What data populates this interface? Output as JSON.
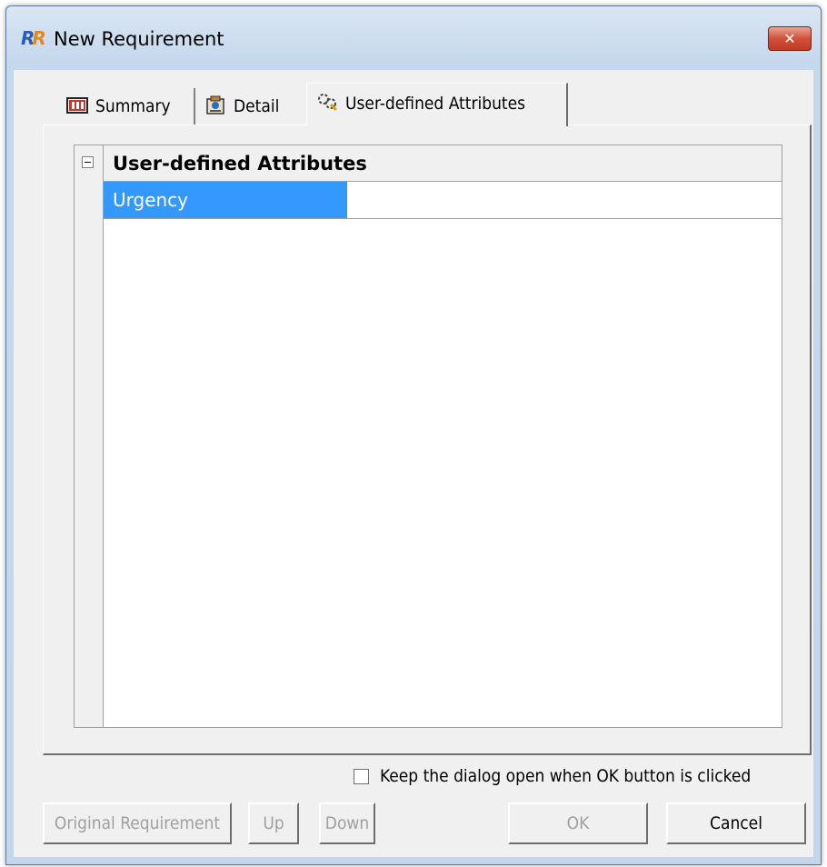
{
  "window": {
    "title": "New Requirement",
    "close_glyph": "✕"
  },
  "tabs": [
    {
      "label": "Summary",
      "icon": "summary-book-icon"
    },
    {
      "label": "Detail",
      "icon": "detail-clipboard-icon"
    },
    {
      "label": "User-defined Attributes",
      "icon": "attributes-gears-icon",
      "active": true
    }
  ],
  "grid": {
    "category": "User-defined Attributes",
    "rows": [
      {
        "name": "Urgency",
        "value": "",
        "selected": true
      }
    ]
  },
  "options": {
    "keep_open_label": "Keep the dialog open when OK button is clicked",
    "keep_open_checked": false
  },
  "buttons": {
    "original_requirement": "Original Requirement",
    "up": "Up",
    "down": "Down",
    "ok": "OK",
    "cancel": "Cancel"
  },
  "colors": {
    "selection": "#3399ff",
    "dialog_bg": "#f0f0f0",
    "title_bar": "#c6d8ec",
    "close_button": "#d3503a"
  }
}
